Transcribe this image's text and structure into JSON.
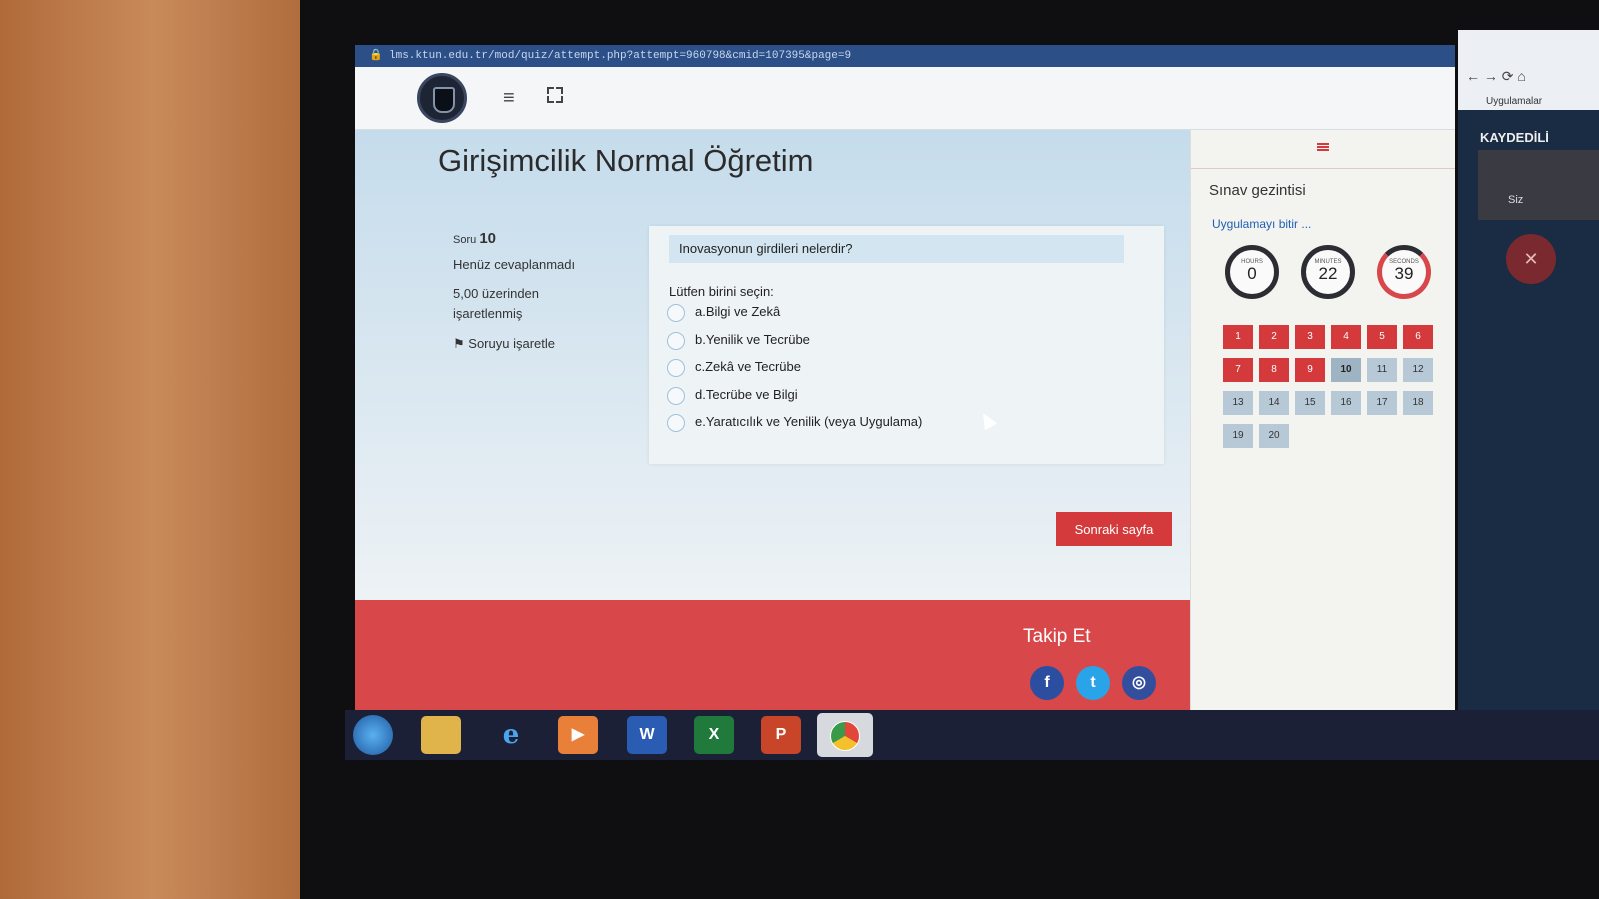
{
  "browser": {
    "url": "lms.ktun.edu.tr/mod/quiz/attempt.php?attempt=960798&cmid=107395&page=9"
  },
  "header": {
    "title": "Girişimcilik Normal Öğretim"
  },
  "question": {
    "label": "Soru",
    "number": "10",
    "state": "Henüz cevaplanmadı",
    "grade_line1": "5,00 üzerinden",
    "grade_line2": "işaretlenmiş",
    "flag_label": "Soruyu işaretle",
    "text": "Inovasyonun girdileri nelerdir?",
    "prompt": "Lütfen birini seçin:",
    "options": [
      {
        "label": "a.Bilgi ve Zekâ"
      },
      {
        "label": "b.Yenilik ve Tecrübe"
      },
      {
        "label": "c.Zekâ ve Tecrübe"
      },
      {
        "label": "d.Tecrübe ve Bilgi"
      },
      {
        "label": "e.Yaratıcılık ve Yenilik (veya Uygulama)"
      }
    ]
  },
  "actions": {
    "next_label": "Sonraki sayfa"
  },
  "footer": {
    "follow_label": "Takip Et",
    "facebook": "f",
    "twitter": "t",
    "instagram": "◎"
  },
  "quiz_nav": {
    "title": "Sınav gezintisi",
    "finish_label": "Uygulamayı bitir ...",
    "timer": {
      "hours_label": "HOURS",
      "hours": "0",
      "minutes_label": "MINUTES",
      "minutes": "22",
      "seconds_label": "SECONDS",
      "seconds": "39"
    },
    "questions": [
      "1",
      "2",
      "3",
      "4",
      "5",
      "6",
      "7",
      "8",
      "9",
      "10",
      "11",
      "12",
      "13",
      "14",
      "15",
      "16",
      "17",
      "18",
      "19",
      "20"
    ],
    "answered_color": "#d43a3c",
    "pending_color": "#b7c9d6"
  },
  "side_window": {
    "apps_label": "Uygulamalar",
    "recording": "KAYDEDİLİ",
    "self_label": "Siz"
  },
  "taskbar": {
    "word": "W",
    "excel": "X",
    "ppt": "P"
  }
}
